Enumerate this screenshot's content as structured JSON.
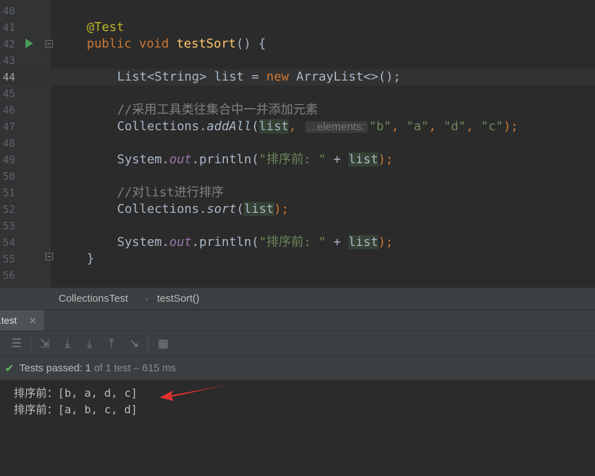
{
  "editor": {
    "line_numbers": [
      "40",
      "41",
      "42",
      "43",
      "44",
      "45",
      "46",
      "47",
      "48",
      "49",
      "50",
      "51",
      "52",
      "53",
      "54",
      "55",
      "56"
    ],
    "current_line": "44",
    "code": {
      "annotation": "@Test",
      "public": "public",
      "void": "void",
      "method_name": "testSort",
      "method_sig_end": "() {",
      "l44_type": "List<String> ",
      "list_var": "list",
      "assign": " = ",
      "new_kw": "new",
      "l44_rest": " ArrayList<>();",
      "comment_add": "//采用工具类往集合中一并添加元素",
      "collections": "Collections",
      "dot": ".",
      "add_all": "addAll",
      "open_paren": "(",
      "comma": ",",
      "param_hint": "...elements:",
      "str_b": "\"b\"",
      "str_a": "\"a\"",
      "str_d": "\"d\"",
      "str_c": "\"c\"",
      "sep": ", ",
      "close_stmt": ");",
      "system": "System",
      "out": "out",
      "println": ".println(",
      "str_before": "\"排序前: \"",
      "plus": " + ",
      "comment_sort": "//对list进行排序",
      "sort": "sort",
      "close_brace": "}"
    }
  },
  "breadcrumb": {
    "class_name": "CollectionsTest",
    "separator": "›",
    "method": "testSort()"
  },
  "run_panel": {
    "tab_label": ".test",
    "tab_close": "✕",
    "toolbar_icons": [
      "rerun-icon",
      "sort-alpha-icon",
      "import-icon",
      "export-icon",
      "expand-icon",
      "collapse-icon",
      "autoscroll-icon",
      "more-icon"
    ],
    "status_main": "Tests passed: 1",
    "status_detail": " of 1 test – 615 ms",
    "check_symbol": "✔",
    "output_lines": [
      "排序前：[b, a, d, c]",
      "排序前：[a, b, c, d]"
    ]
  },
  "annotation_arrow": {
    "color": "#e8312f"
  }
}
